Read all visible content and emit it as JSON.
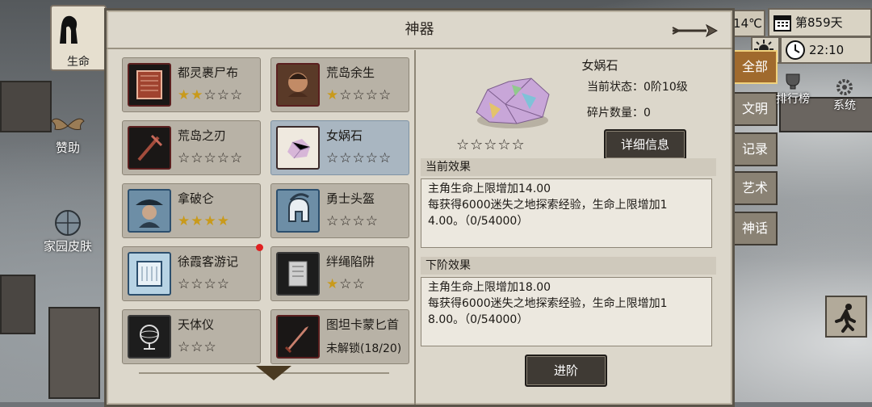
{
  "dialog": {
    "title": "神器"
  },
  "artifacts": [
    {
      "name": "都灵裹尸布",
      "stars_on": 2,
      "stars_total": 5
    },
    {
      "name": "荒岛余生",
      "stars_on": 1,
      "stars_total": 5
    },
    {
      "name": "荒岛之刃",
      "stars_on": 0,
      "stars_total": 5
    },
    {
      "name": "女娲石",
      "stars_on": 0,
      "stars_total": 5
    },
    {
      "name": "拿破仑",
      "stars_on": 4,
      "stars_total": 4
    },
    {
      "name": "勇士头盔",
      "stars_on": 0,
      "stars_total": 4
    },
    {
      "name": "徐霞客游记",
      "stars_on": 0,
      "stars_total": 4
    },
    {
      "name": "绊绳陷阱",
      "stars_on": 1,
      "stars_total": 3
    },
    {
      "name": "天体仪",
      "stars_on": 0,
      "stars_total": 3
    },
    {
      "name": "图坦卡蒙匕首",
      "lock_text": "未解锁(18/20)"
    }
  ],
  "detail": {
    "name": "女娲石",
    "status_label": "当前状态：",
    "status_value": "0阶10级",
    "fragments_label": "碎片数量：",
    "fragments_value": "0",
    "stars": "☆☆☆☆☆",
    "detail_button": "详细信息",
    "current_effect": {
      "title": "当前效果",
      "lines": [
        "主角生命上限增加14.00",
        "每获得6000迷失之地探索经验，生命上限增加1",
        "4.00。（0/54000）"
      ]
    },
    "next_effect": {
      "title": "下阶效果",
      "lines": [
        "主角生命上限增加18.00",
        "每获得6000迷失之地探索经验，生命上限增加1",
        "8.00。（0/54000）"
      ]
    },
    "advance_button": "进阶"
  },
  "hud": {
    "temperature": "14℃",
    "day": "第859天",
    "time": "22:10"
  },
  "left_side": {
    "life": "生命",
    "help": "赞助",
    "home_skin": "家园皮肤"
  },
  "right_side": {
    "rank": "排行榜",
    "system": "系统"
  },
  "right_tabs": [
    "全部",
    "文明",
    "记录",
    "艺术",
    "神话"
  ]
}
